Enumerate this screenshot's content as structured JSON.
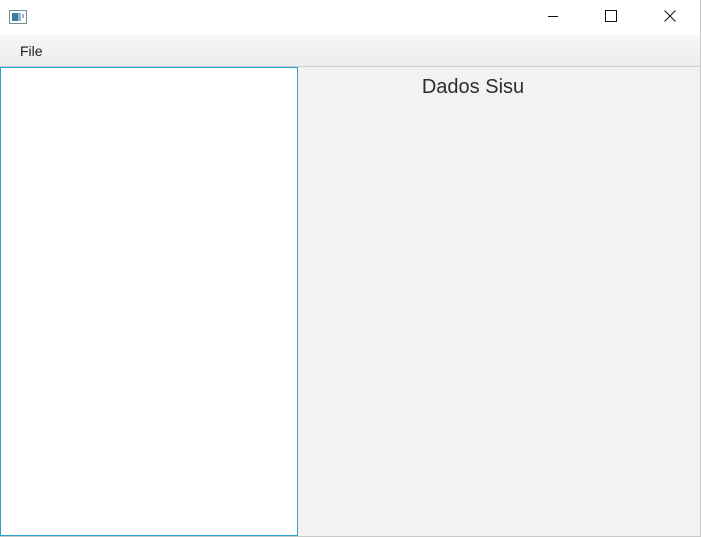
{
  "window": {
    "icon": "java-app-icon",
    "controls": {
      "minimize": "minimize-icon",
      "maximize": "maximize-icon",
      "close": "close-icon"
    }
  },
  "menubar": {
    "items": [
      {
        "label": "File"
      }
    ]
  },
  "right_panel": {
    "title": "Dados Sisu"
  },
  "colors": {
    "left_pane_border": "#2b9fd0",
    "right_pane_background": "#f2f2f2",
    "menubar_background": "#ededed"
  }
}
